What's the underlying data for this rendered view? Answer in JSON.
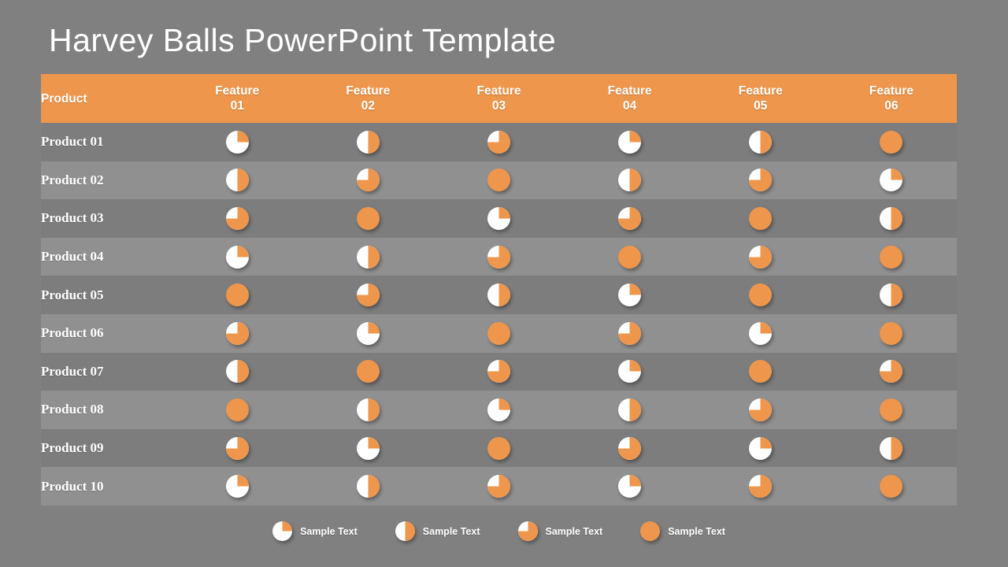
{
  "slide": {
    "title": "Harvey Balls PowerPoint Template",
    "background_color": "#808080",
    "accent_color": "#ee964b",
    "ball_fill_color": "#ee964b",
    "ball_empty_color": "#ffffff",
    "row_odd_color": "#7d7d7d",
    "row_even_color": "#909090"
  },
  "table": {
    "columns": [
      {
        "label": "Product",
        "line1": "Product",
        "line2": ""
      },
      {
        "label": "Feature 01",
        "line1": "Feature",
        "line2": "01"
      },
      {
        "label": "Feature 02",
        "line1": "Feature",
        "line2": "02"
      },
      {
        "label": "Feature 03",
        "line1": "Feature",
        "line2": "03"
      },
      {
        "label": "Feature 04",
        "line1": "Feature",
        "line2": "04"
      },
      {
        "label": "Feature 05",
        "line1": "Feature",
        "line2": "05"
      },
      {
        "label": "Feature 06",
        "line1": "Feature",
        "line2": "06"
      }
    ],
    "rows": [
      {
        "product": "Product 01",
        "values": [
          0.25,
          0.5,
          0.75,
          0.25,
          0.5,
          1
        ]
      },
      {
        "product": "Product 02",
        "values": [
          0.5,
          0.75,
          1,
          0.5,
          0.75,
          0.25
        ]
      },
      {
        "product": "Product 03",
        "values": [
          0.75,
          1,
          0.25,
          0.75,
          1,
          0.5
        ]
      },
      {
        "product": "Product 04",
        "values": [
          0.25,
          0.5,
          0.75,
          1,
          0.75,
          1
        ]
      },
      {
        "product": "Product 05",
        "values": [
          1,
          0.75,
          0.5,
          0.25,
          1,
          0.5
        ]
      },
      {
        "product": "Product 06",
        "values": [
          0.75,
          0.25,
          1,
          0.75,
          0.25,
          1
        ]
      },
      {
        "product": "Product 07",
        "values": [
          0.5,
          1,
          0.75,
          0.25,
          1,
          0.75
        ]
      },
      {
        "product": "Product 08",
        "values": [
          1,
          0.5,
          0.25,
          0.5,
          0.75,
          1
        ]
      },
      {
        "product": "Product 09",
        "values": [
          0.75,
          0.25,
          1,
          0.75,
          0.25,
          0.5
        ]
      },
      {
        "product": "Product 10",
        "values": [
          0.25,
          0.5,
          0.75,
          0.25,
          0.75,
          1
        ]
      }
    ]
  },
  "legend": {
    "items": [
      {
        "value": 0.25,
        "label": "Sample Text"
      },
      {
        "value": 0.5,
        "label": "Sample Text"
      },
      {
        "value": 0.75,
        "label": "Sample Text"
      },
      {
        "value": 1,
        "label": "Sample Text"
      }
    ]
  }
}
